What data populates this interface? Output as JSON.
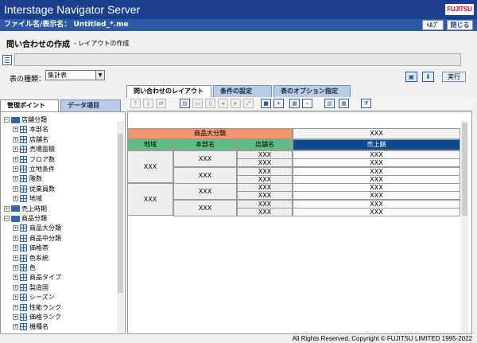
{
  "app": {
    "title": "Interstage Navigator Server",
    "logo": "FUJITSU"
  },
  "file": {
    "label": "ファイル名/表示名：",
    "name": "Untitled_*.me"
  },
  "toolbar": {
    "help": "ﾍﾙﾌﾟ",
    "close": "閉じる"
  },
  "page": {
    "title": "問い合わせの作成",
    "subtitle": "- レイアウトの作成"
  },
  "type_select": {
    "label": "表の種類：",
    "value": "集計表"
  },
  "run_label": "実行",
  "tabs": [
    {
      "label": "問い合わせのレイアウト",
      "active": true
    },
    {
      "label": "条件の設定",
      "active": false
    },
    {
      "label": "表のオプション指定",
      "active": false
    }
  ],
  "left_tabs": [
    {
      "label": "管理ポイント",
      "active": true
    },
    {
      "label": "データ項目",
      "active": false
    }
  ],
  "tree": [
    {
      "label": "店舗分類",
      "level": 0,
      "type": "folder",
      "sign": "−"
    },
    {
      "label": "本部名",
      "level": 1,
      "type": "item",
      "sign": "+"
    },
    {
      "label": "店舗名",
      "level": 1,
      "type": "item",
      "sign": "+"
    },
    {
      "label": "売場面積",
      "level": 1,
      "type": "item",
      "sign": "+"
    },
    {
      "label": "フロア数",
      "level": 1,
      "type": "item",
      "sign": "+"
    },
    {
      "label": "立地条件",
      "level": 1,
      "type": "item",
      "sign": "+"
    },
    {
      "label": "階数",
      "level": 1,
      "type": "item",
      "sign": "+"
    },
    {
      "label": "従業員数",
      "level": 1,
      "type": "item",
      "sign": "+"
    },
    {
      "label": "地域",
      "level": 1,
      "type": "item",
      "sign": "+"
    },
    {
      "label": "売上時期",
      "level": 0,
      "type": "folder",
      "sign": "+"
    },
    {
      "label": "商品分類",
      "level": 0,
      "type": "folder",
      "sign": "−"
    },
    {
      "label": "商品大分類",
      "level": 1,
      "type": "item",
      "sign": "+"
    },
    {
      "label": "商品中分類",
      "level": 1,
      "type": "item",
      "sign": "+"
    },
    {
      "label": "価格帯",
      "level": 1,
      "type": "item",
      "sign": "+"
    },
    {
      "label": "色系統",
      "level": 1,
      "type": "item",
      "sign": "+"
    },
    {
      "label": "色",
      "level": 1,
      "type": "item",
      "sign": "+"
    },
    {
      "label": "商品タイプ",
      "level": 1,
      "type": "item",
      "sign": "+"
    },
    {
      "label": "製造国",
      "level": 1,
      "type": "item",
      "sign": "+"
    },
    {
      "label": "シーズン",
      "level": 1,
      "type": "item",
      "sign": "+"
    },
    {
      "label": "性能ランク",
      "level": 1,
      "type": "item",
      "sign": "+"
    },
    {
      "label": "価格ランク",
      "level": 1,
      "type": "item",
      "sign": "+"
    },
    {
      "label": "機種名",
      "level": 1,
      "type": "item",
      "sign": "+"
    }
  ],
  "layout": {
    "col_dim_label": "商品大分類",
    "col_dim_value": "XXX",
    "row_headers": [
      "地域",
      "本部名",
      "店舗名"
    ],
    "measure": "売上額",
    "placeholder": "XXX"
  },
  "colors": {
    "accent": "#1a3f8c",
    "col_dim": "#f4956b",
    "row_dim": "#5cbd84",
    "measure": "#0d4a8e"
  },
  "footer": "All Rights Reserved, Copyright © FUJITSU LIMITED 1995-2022"
}
